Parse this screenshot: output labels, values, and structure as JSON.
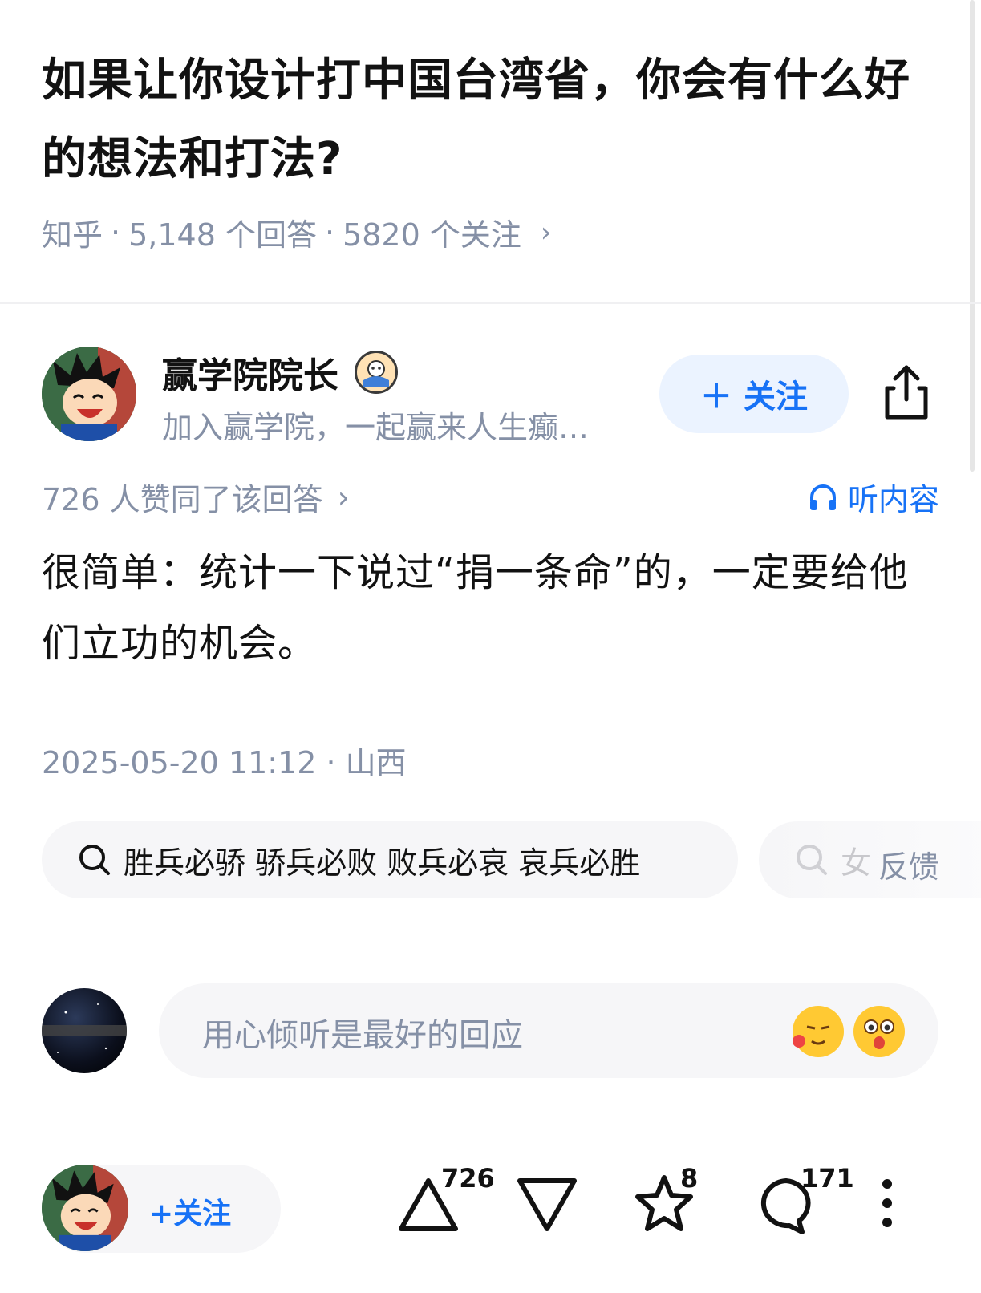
{
  "question": {
    "title": "如果让你设计打中国台湾省，你会有什么好的想法和打法?",
    "source": "知乎",
    "answers": "5,148 个回答",
    "follows": "5820 个关注"
  },
  "author": {
    "name": "赢学院院长",
    "description": "加入赢学院，一起赢来人生癫…",
    "follow_label": "关注"
  },
  "answer": {
    "votes_text": "726 人赞同了该回答",
    "listen_label": "听内容",
    "body": "很简单：统计一下说过“捐一条命”的，一定要给他们立功的机会。",
    "time_location": "2025-05-20 11:12 · 山西"
  },
  "search_suggestions": [
    {
      "text": "胜兵必骄 骄兵必败 败兵必哀 哀兵必胜"
    },
    {
      "text": "女"
    }
  ],
  "feedback_label": "反馈",
  "comment": {
    "placeholder": "用心倾听是最好的回应"
  },
  "bottom_bar": {
    "follow_label": "+关注",
    "upvotes": "726",
    "favorites": "8",
    "comments": "171"
  },
  "colors": {
    "accent": "#1772f6",
    "meta_gray": "#8590a6",
    "chip_bg": "#f6f6f8",
    "follow_bg": "#ebf3ff"
  }
}
